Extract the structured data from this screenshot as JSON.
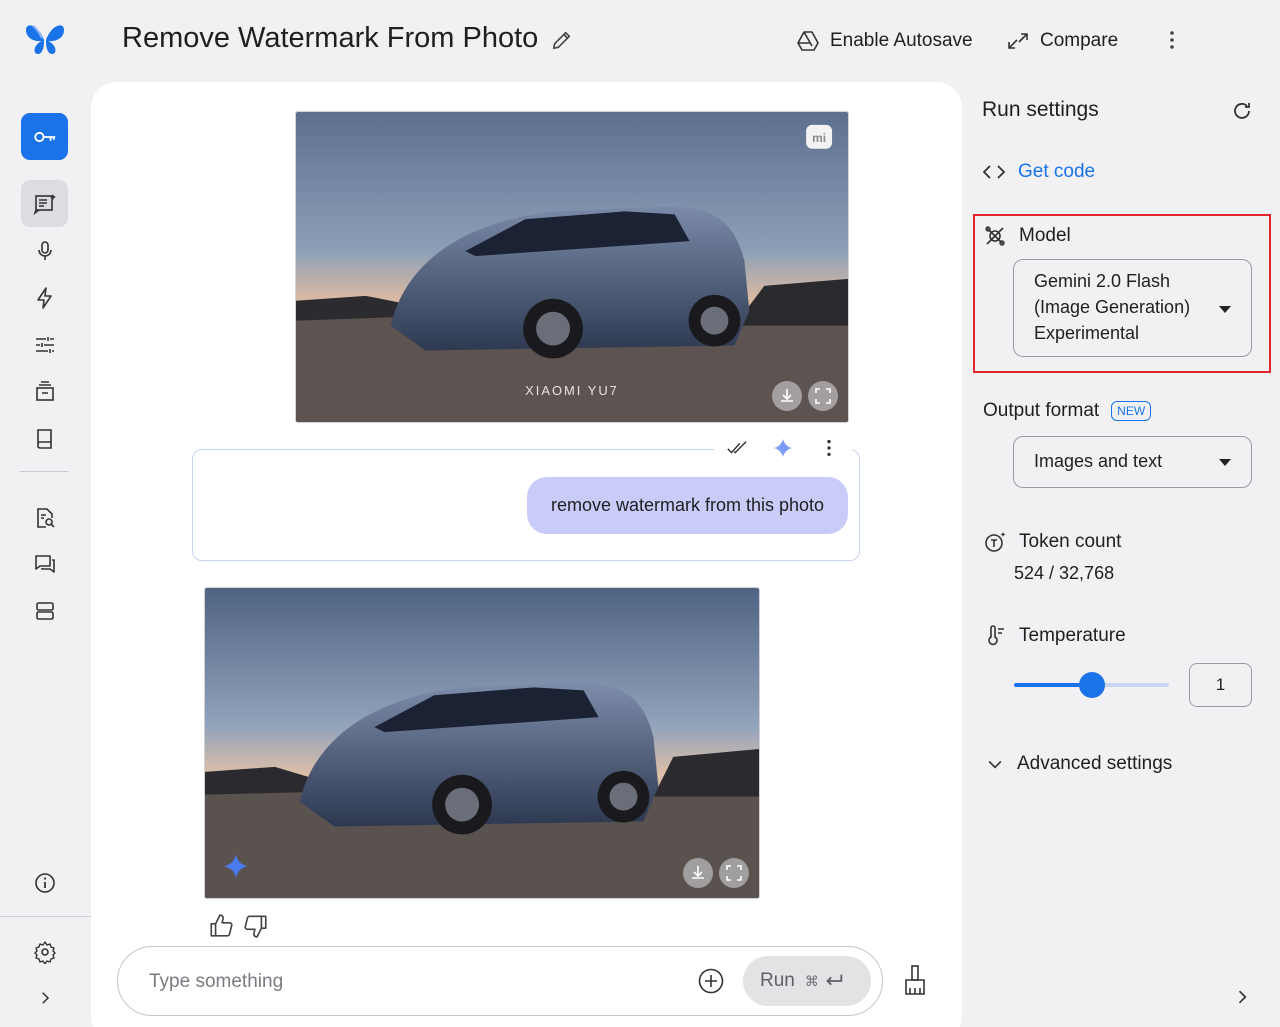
{
  "header": {
    "title": "Remove Watermark From Photo",
    "autosave_label": "Enable Autosave",
    "compare_label": "Compare"
  },
  "chat": {
    "user_message": "remove watermark from this photo",
    "input_placeholder": "Type something",
    "run_label": "Run",
    "image1_watermark": "XIAOMI YU7",
    "image1_brand": "mi"
  },
  "run_settings": {
    "title": "Run settings",
    "get_code_label": "Get code",
    "model_label": "Model",
    "model_value": "Gemini 2.0 Flash (Image Generation) Experimental",
    "output_format_label": "Output format",
    "new_badge": "NEW",
    "output_format_value": "Images and text",
    "token_count_label": "Token count",
    "token_count_value": "524 / 32,768",
    "temperature_label": "Temperature",
    "temperature_value": "1",
    "temperature_fraction": 0.5,
    "advanced_settings_label": "Advanced settings"
  },
  "colors": {
    "accent": "#1a73e8",
    "bubble": "#c9ccf9",
    "highlight_border": "#e0262b"
  }
}
